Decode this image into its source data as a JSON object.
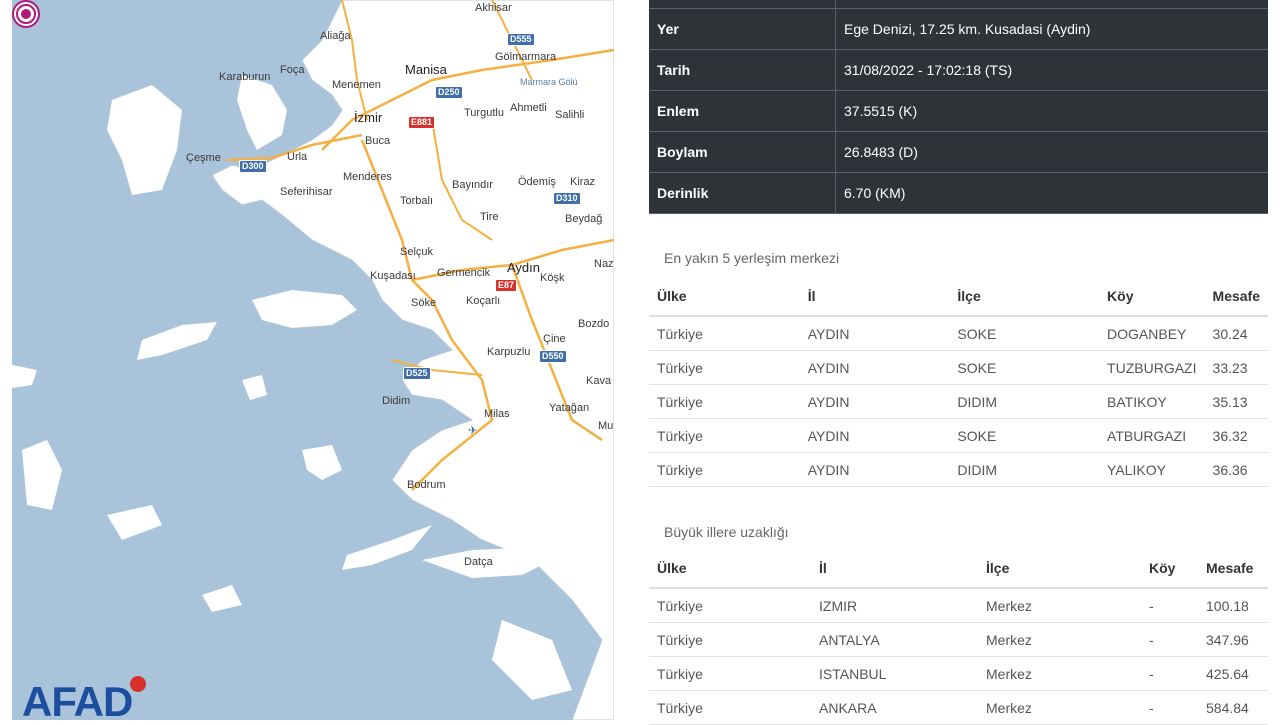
{
  "map": {
    "places": [
      {
        "name": "Akhisar"
      },
      {
        "name": "Aliağa"
      },
      {
        "name": "Gölmarmara"
      },
      {
        "name": "Karaburun"
      },
      {
        "name": "Foça"
      },
      {
        "name": "Manisa"
      },
      {
        "name": "Marmara Gölü"
      },
      {
        "name": "Menemen"
      },
      {
        "name": "Ahmetli"
      },
      {
        "name": "Turgutlu"
      },
      {
        "name": "Salihli"
      },
      {
        "name": "İzmir"
      },
      {
        "name": "Buca"
      },
      {
        "name": "Çeşme"
      },
      {
        "name": "Urla"
      },
      {
        "name": "Seferihisar"
      },
      {
        "name": "Menderes"
      },
      {
        "name": "Bayındır"
      },
      {
        "name": "Ödemiş"
      },
      {
        "name": "Kiraz"
      },
      {
        "name": "Torbalı"
      },
      {
        "name": "Tire"
      },
      {
        "name": "Beydağ"
      },
      {
        "name": "Selçuk"
      },
      {
        "name": "Kuşadası"
      },
      {
        "name": "Germencik"
      },
      {
        "name": "Aydın"
      },
      {
        "name": "Köşk"
      },
      {
        "name": "Naz"
      },
      {
        "name": "Söke"
      },
      {
        "name": "Koçarlı"
      },
      {
        "name": "Bozdo"
      },
      {
        "name": "Çine"
      },
      {
        "name": "Karpuzlu"
      },
      {
        "name": "Kava"
      },
      {
        "name": "Didim"
      },
      {
        "name": "Milas"
      },
      {
        "name": "Yatağan"
      },
      {
        "name": "Mu"
      },
      {
        "name": "Bodrum"
      },
      {
        "name": "Datça"
      }
    ],
    "roads": [
      {
        "label": "D555",
        "type": "d"
      },
      {
        "label": "D250",
        "type": "d"
      },
      {
        "label": "E881",
        "type": "e"
      },
      {
        "label": "D300",
        "type": "d"
      },
      {
        "label": "D310",
        "type": "d"
      },
      {
        "label": "E87",
        "type": "e"
      },
      {
        "label": "D550",
        "type": "d"
      },
      {
        "label": "D525",
        "type": "d"
      }
    ],
    "logo": "AFAD",
    "colors": {
      "sea": "#a9c3db",
      "land": "#ffffff",
      "epicenter": "#b0177e",
      "logo": "#1b4f9e"
    }
  },
  "info": [
    {
      "key": "Yer",
      "value": "Ege Denizi, 17.25 km. Kusadasi (Aydin)"
    },
    {
      "key": "Tarih",
      "value": "31/08/2022 - 17:02:18 (TS)"
    },
    {
      "key": "Enlem",
      "value": "37.5515 (K)"
    },
    {
      "key": "Boylam",
      "value": "26.8483 (D)"
    },
    {
      "key": "Derinlik",
      "value": "6.70 (KM)"
    }
  ],
  "nearest": {
    "title": "En yakın 5 yerleşim merkezi",
    "headers": [
      "Ülke",
      "İl",
      "İlçe",
      "Köy",
      "Mesafe"
    ],
    "rows": [
      [
        "Türkiye",
        "AYDIN",
        "SOKE",
        "DOGANBEY",
        "30.24"
      ],
      [
        "Türkiye",
        "AYDIN",
        "SOKE",
        "TUZBURGAZI",
        "33.23"
      ],
      [
        "Türkiye",
        "AYDIN",
        "DIDIM",
        "BATIKOY",
        "35.13"
      ],
      [
        "Türkiye",
        "AYDIN",
        "SOKE",
        "ATBURGAZI",
        "36.32"
      ],
      [
        "Türkiye",
        "AYDIN",
        "DIDIM",
        "YALIKOY",
        "36.36"
      ]
    ]
  },
  "cities": {
    "title": "Büyük illere uzaklığı",
    "headers": [
      "Ülke",
      "İl",
      "İlçe",
      "Köy",
      "Mesafe"
    ],
    "rows": [
      [
        "Türkiye",
        "IZMIR",
        "Merkez",
        "-",
        "100.18"
      ],
      [
        "Türkiye",
        "ANTALYA",
        "Merkez",
        "-",
        "347.96"
      ],
      [
        "Türkiye",
        "ISTANBUL",
        "Merkez",
        "-",
        "425.64"
      ],
      [
        "Türkiye",
        "ANKARA",
        "Merkez",
        "-",
        "584.84"
      ]
    ]
  }
}
